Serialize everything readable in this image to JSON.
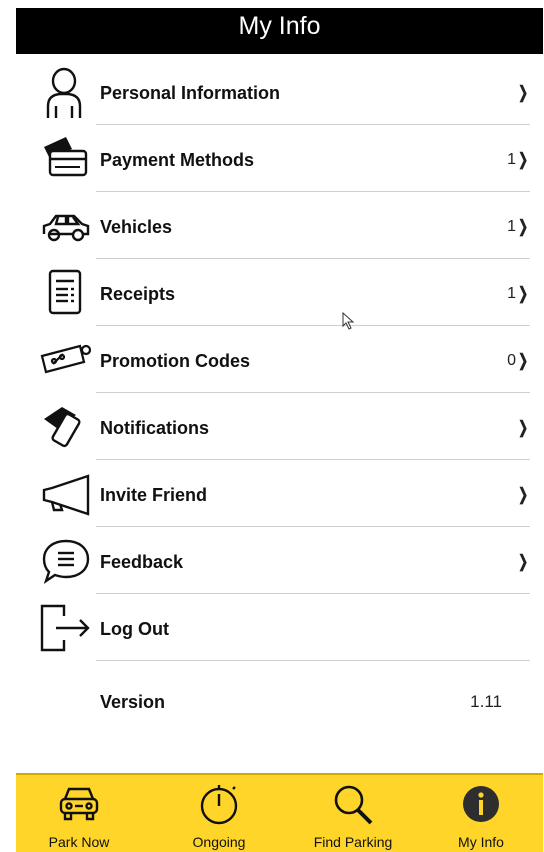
{
  "header": {
    "title": "My Info"
  },
  "menu": {
    "items": [
      {
        "label": "Personal Information",
        "count": "",
        "chevron": "❯",
        "icon": "person-icon"
      },
      {
        "label": "Payment Methods",
        "count": "1",
        "chevron": "❯",
        "icon": "credit-card-icon"
      },
      {
        "label": "Vehicles",
        "count": "1",
        "chevron": "❯",
        "icon": "car-icon"
      },
      {
        "label": "Receipts",
        "count": "1",
        "chevron": "❯",
        "icon": "receipt-icon"
      },
      {
        "label": "Promotion Codes",
        "count": "0",
        "chevron": "❯",
        "icon": "coupon-icon"
      },
      {
        "label": "Notifications",
        "count": "",
        "chevron": "❯",
        "icon": "notification-icon"
      },
      {
        "label": "Invite Friend",
        "count": "",
        "chevron": "❯",
        "icon": "megaphone-icon"
      },
      {
        "label": "Feedback",
        "count": "",
        "chevron": "❯",
        "icon": "chat-bubble-icon"
      },
      {
        "label": "Log Out",
        "count": "",
        "chevron": "",
        "icon": "logout-icon"
      }
    ]
  },
  "version": {
    "label": "Version",
    "value": "1.11"
  },
  "tabbar": {
    "tabs": [
      {
        "label": "Park Now",
        "icon": "car-front-icon"
      },
      {
        "label": "Ongoing",
        "icon": "stopwatch-icon"
      },
      {
        "label": "Find Parking",
        "icon": "magnifier-icon"
      },
      {
        "label": "My Info",
        "icon": "info-icon",
        "active": true
      }
    ]
  },
  "colors": {
    "header_bg": "#000000",
    "tabbar_bg": "#ffd52a",
    "divider": "#cfcfcf"
  }
}
